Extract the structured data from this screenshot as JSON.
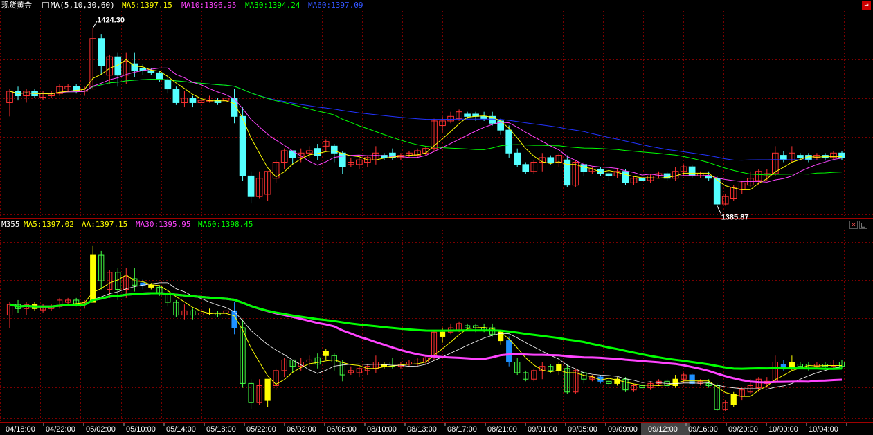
{
  "top_legend": {
    "symbol": "现货黄金",
    "indicator": "MA(5,10,30,60)",
    "ma5": "MA5:1397.15",
    "ma10": "MA10:1396.95",
    "ma30": "MA30:1394.24",
    "ma60": "MA60:1397.09"
  },
  "bottom_legend": {
    "name": "M355",
    "ma5": "MA5:1397.02",
    "aa": "AA:1397.15",
    "ma30": "MA30:1395.95",
    "ma60": "MA60:1398.45"
  },
  "annotations": {
    "high": "1424.30",
    "low": "1385.87"
  },
  "colors": {
    "up": "#ff3232",
    "down": "#54ffff",
    "ma5": "#ffff00",
    "ma10": "#ff44ff",
    "ma30": "#00ff00",
    "ma60": "#2233ff",
    "grid": "#7a0000",
    "v_up": "#ff3232",
    "v_down": "#44ff44",
    "v_flat": "#ffff00",
    "v_blue": "#1e90ff"
  },
  "window_buttons": {
    "close": "×",
    "restore": "□",
    "minimize": "-"
  },
  "chart_data": [
    {
      "type": "candlestick",
      "title": "现货黄金",
      "ylim": [
        1383,
        1428
      ],
      "x_tick_labels": [
        "04/18:00",
        "04/22:00",
        "05/02:00",
        "05/10:00",
        "05/14:00",
        "05/18:00",
        "05/22:00",
        "06/02:00",
        "06/06:00",
        "08/10:00",
        "08/13:00",
        "08/17:00",
        "08/21:00",
        "09/01:00",
        "09/05:00",
        "09/09:00",
        "09/12:00",
        "09/16:00",
        "09/20:00",
        "10/00:00",
        "10/04:00"
      ],
      "candles": [
        [
          1408.0,
          1410.5,
          1405.0,
          1411.0
        ],
        [
          1410.5,
          1409.5,
          1408.5,
          1411.5
        ],
        [
          1409.5,
          1410.5,
          1408.0,
          1411.0
        ],
        [
          1410.5,
          1409.5,
          1409.0,
          1411.0
        ],
        [
          1409.2,
          1410.0,
          1408.6,
          1410.6
        ],
        [
          1409.5,
          1410.0,
          1409.0,
          1410.5
        ],
        [
          1410.0,
          1411.5,
          1409.5,
          1412.0
        ],
        [
          1411.0,
          1411.5,
          1410.5,
          1412.0
        ],
        [
          1411.5,
          1410.5,
          1410.0,
          1412.0
        ],
        [
          1410.5,
          1411.0,
          1409.5,
          1411.5
        ],
        [
          1411.0,
          1422.0,
          1411.0,
          1424.3
        ],
        [
          1422.0,
          1416.0,
          1414.0,
          1423.0
        ],
        [
          1414.0,
          1418.0,
          1412.0,
          1418.5
        ],
        [
          1418.0,
          1414.0,
          1411.5,
          1419.0
        ],
        [
          1414.0,
          1417.0,
          1412.0,
          1419.0
        ],
        [
          1416.5,
          1415.0,
          1413.5,
          1419.0
        ],
        [
          1415.5,
          1415.0,
          1414.0,
          1416.5
        ],
        [
          1415.0,
          1414.5,
          1414.0,
          1415.5
        ],
        [
          1414.5,
          1413.0,
          1412.5,
          1415.0
        ],
        [
          1413.0,
          1411.0,
          1410.0,
          1414.0
        ],
        [
          1411.0,
          1408.0,
          1407.5,
          1411.5
        ],
        [
          1408.0,
          1409.0,
          1407.0,
          1410.5
        ],
        [
          1409.0,
          1408.0,
          1407.0,
          1409.5
        ],
        [
          1408.0,
          1408.5,
          1407.5,
          1409.0
        ],
        [
          1408.5,
          1408.5,
          1408.0,
          1409.5
        ],
        [
          1408.5,
          1408.0,
          1407.5,
          1409.0
        ],
        [
          1408.5,
          1409.0,
          1407.5,
          1409.5
        ],
        [
          1409.0,
          1405.0,
          1403.5,
          1411.0
        ],
        [
          1405.0,
          1392.0,
          1391.0,
          1407.0
        ],
        [
          1392.0,
          1387.5,
          1386.0,
          1393.0
        ],
        [
          1387.5,
          1391.5,
          1387.0,
          1393.0
        ],
        [
          1388.0,
          1393.0,
          1386.5,
          1393.0
        ],
        [
          1391.5,
          1395.0,
          1390.5,
          1395.5
        ],
        [
          1395.0,
          1397.5,
          1393.5,
          1398.0
        ],
        [
          1397.5,
          1396.0,
          1394.5,
          1397.5
        ],
        [
          1396.0,
          1397.0,
          1395.0,
          1398.0
        ],
        [
          1397.0,
          1397.5,
          1396.0,
          1398.5
        ],
        [
          1398.0,
          1396.5,
          1395.5,
          1399.0
        ],
        [
          1398.5,
          1399.5,
          1397.5,
          1400.0
        ],
        [
          1398.5,
          1397.0,
          1395.0,
          1399.0
        ],
        [
          1397.0,
          1394.0,
          1392.5,
          1397.5
        ],
        [
          1394.5,
          1395.0,
          1394.0,
          1396.0
        ],
        [
          1394.5,
          1395.5,
          1393.5,
          1396.0
        ],
        [
          1395.0,
          1396.0,
          1394.0,
          1396.5
        ],
        [
          1395.5,
          1397.0,
          1394.5,
          1398.5
        ],
        [
          1396.5,
          1396.0,
          1395.5,
          1397.0
        ],
        [
          1397.0,
          1396.0,
          1395.5,
          1398.0
        ],
        [
          1396.0,
          1396.5,
          1395.5,
          1397.0
        ],
        [
          1396.5,
          1397.0,
          1396.0,
          1397.5
        ],
        [
          1396.5,
          1397.5,
          1396.0,
          1398.0
        ],
        [
          1397.0,
          1398.0,
          1396.5,
          1398.5
        ],
        [
          1398.0,
          1404.0,
          1397.5,
          1404.5
        ],
        [
          1403.0,
          1404.0,
          1401.5,
          1405.0
        ],
        [
          1404.0,
          1405.0,
          1403.5,
          1406.0
        ],
        [
          1404.5,
          1406.0,
          1404.0,
          1406.5
        ],
        [
          1405.5,
          1405.0,
          1404.5,
          1406.0
        ],
        [
          1405.5,
          1405.0,
          1404.0,
          1406.0
        ],
        [
          1405.0,
          1404.5,
          1404.0,
          1406.0
        ],
        [
          1405.0,
          1403.5,
          1403.0,
          1406.0
        ],
        [
          1404.0,
          1402.0,
          1401.0,
          1404.5
        ],
        [
          1402.0,
          1397.0,
          1396.0,
          1403.0
        ],
        [
          1397.0,
          1394.5,
          1394.0,
          1398.0
        ],
        [
          1394.5,
          1393.0,
          1392.5,
          1395.0
        ],
        [
          1393.0,
          1395.0,
          1392.5,
          1395.5
        ],
        [
          1395.0,
          1396.0,
          1393.0,
          1397.0
        ],
        [
          1396.0,
          1395.0,
          1394.5,
          1396.5
        ],
        [
          1395.0,
          1396.5,
          1394.0,
          1397.0
        ],
        [
          1395.5,
          1390.0,
          1389.5,
          1396.5
        ],
        [
          1390.0,
          1395.0,
          1389.5,
          1395.5
        ],
        [
          1394.5,
          1393.0,
          1392.0,
          1395.0
        ],
        [
          1393.0,
          1393.5,
          1392.5,
          1394.0
        ],
        [
          1393.5,
          1392.5,
          1392.0,
          1394.0
        ],
        [
          1392.5,
          1392.0,
          1391.0,
          1393.5
        ],
        [
          1392.0,
          1393.0,
          1391.5,
          1393.5
        ],
        [
          1393.0,
          1390.5,
          1390.0,
          1393.5
        ],
        [
          1390.5,
          1391.5,
          1390.0,
          1392.0
        ],
        [
          1391.5,
          1391.0,
          1390.0,
          1392.0
        ],
        [
          1391.0,
          1392.0,
          1390.5,
          1392.5
        ],
        [
          1392.0,
          1392.5,
          1391.5,
          1393.0
        ],
        [
          1392.5,
          1391.5,
          1391.0,
          1393.0
        ],
        [
          1391.5,
          1393.0,
          1391.0,
          1394.0
        ],
        [
          1393.0,
          1394.0,
          1392.0,
          1394.5
        ],
        [
          1394.0,
          1392.0,
          1391.5,
          1394.5
        ],
        [
          1392.0,
          1392.5,
          1391.5,
          1393.0
        ],
        [
          1392.0,
          1391.5,
          1391.0,
          1393.0
        ],
        [
          1391.5,
          1385.87,
          1385.5,
          1392.0
        ],
        [
          1385.87,
          1387.5,
          1385.5,
          1388.0
        ],
        [
          1387.0,
          1389.5,
          1386.5,
          1390.0
        ],
        [
          1389.0,
          1390.5,
          1388.0,
          1391.0
        ],
        [
          1390.0,
          1391.5,
          1389.5,
          1393.0
        ],
        [
          1391.0,
          1393.0,
          1390.0,
          1393.5
        ],
        [
          1392.0,
          1392.5,
          1391.0,
          1393.5
        ],
        [
          1392.5,
          1397.0,
          1392.0,
          1398.5
        ],
        [
          1396.5,
          1395.5,
          1395.0,
          1397.5
        ],
        [
          1395.5,
          1397.0,
          1395.0,
          1398.5
        ],
        [
          1396.5,
          1396.0,
          1395.5,
          1397.0
        ],
        [
          1396.5,
          1395.5,
          1395.0,
          1397.0
        ],
        [
          1396.0,
          1396.5,
          1395.5,
          1397.0
        ],
        [
          1396.5,
          1396.0,
          1395.5,
          1397.0
        ],
        [
          1396.0,
          1397.0,
          1395.5,
          1397.5
        ],
        [
          1397.0,
          1396.0,
          1395.5,
          1397.5
        ]
      ]
    },
    {
      "type": "candlestick",
      "title": "M355",
      "note": "Lower pane shows the same price bars overlaid with thick MA30 and MA60 lines."
    }
  ]
}
